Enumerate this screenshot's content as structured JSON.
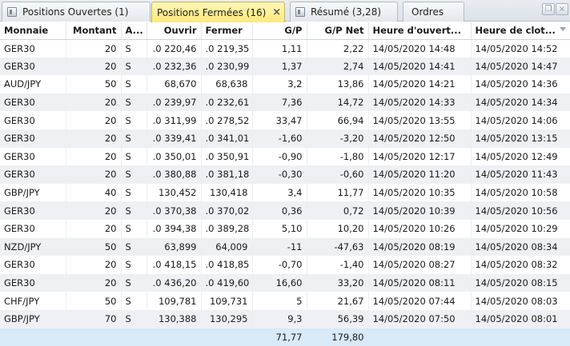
{
  "tabs": [
    {
      "label": "Positions Ouvertes (1)"
    },
    {
      "label": "Positions Fermées (16)",
      "close": "×"
    },
    {
      "label": "Résumé (3,28)"
    },
    {
      "label": "Ordres"
    }
  ],
  "window_buttons": {
    "restore": "❐",
    "close": "×"
  },
  "columns": [
    "Monnaie",
    "Montant",
    "A...",
    "Ouvrir",
    "Fermer",
    "G/P",
    "G/P Net",
    "Heure d'ouvert...",
    "Heure de clot..."
  ],
  "rows": [
    [
      "GER30",
      "20",
      "S",
      ".0 220,46",
      ".0 219,35",
      "1,11",
      "2,22",
      "14/05/2020 14:48",
      "14/05/2020 14:52"
    ],
    [
      "GER30",
      "20",
      "S",
      ".0 232,36",
      ".0 230,99",
      "1,37",
      "2,74",
      "14/05/2020 14:41",
      "14/05/2020 14:47"
    ],
    [
      "AUD/JPY",
      "50",
      "S",
      "68,670",
      "68,638",
      "3,2",
      "13,86",
      "14/05/2020 14:21",
      "14/05/2020 14:36"
    ],
    [
      "GER30",
      "20",
      "S",
      ".0 239,97",
      ".0 232,61",
      "7,36",
      "14,72",
      "14/05/2020 14:33",
      "14/05/2020 14:34"
    ],
    [
      "GER30",
      "20",
      "S",
      ".0 311,99",
      ".0 278,52",
      "33,47",
      "66,94",
      "14/05/2020 13:55",
      "14/05/2020 14:06"
    ],
    [
      "GER30",
      "20",
      "S",
      ".0 339,41",
      ".0 341,01",
      "-1,60",
      "-3,20",
      "14/05/2020 12:50",
      "14/05/2020 13:15"
    ],
    [
      "GER30",
      "20",
      "S",
      ".0 350,01",
      ".0 350,91",
      "-0,90",
      "-1,80",
      "14/05/2020 12:17",
      "14/05/2020 12:49"
    ],
    [
      "GER30",
      "20",
      "S",
      ".0 380,88",
      ".0 381,18",
      "-0,30",
      "-0,60",
      "14/05/2020 11:20",
      "14/05/2020 11:43"
    ],
    [
      "GBP/JPY",
      "40",
      "S",
      "130,452",
      "130,418",
      "3,4",
      "11,77",
      "14/05/2020 10:35",
      "14/05/2020 10:58"
    ],
    [
      "GER30",
      "20",
      "S",
      ".0 370,38",
      ".0 370,02",
      "0,36",
      "0,72",
      "14/05/2020 10:39",
      "14/05/2020 10:56"
    ],
    [
      "GER30",
      "20",
      "S",
      ".0 394,38",
      ".0 389,28",
      "5,10",
      "10,20",
      "14/05/2020 10:26",
      "14/05/2020 10:29"
    ],
    [
      "NZD/JPY",
      "50",
      "S",
      "63,899",
      "64,009",
      "-11",
      "-47,63",
      "14/05/2020 08:19",
      "14/05/2020 08:34"
    ],
    [
      "GER30",
      "20",
      "S",
      ".0 418,15",
      ".0 418,85",
      "-0,70",
      "-1,40",
      "14/05/2020 08:27",
      "14/05/2020 08:32"
    ],
    [
      "GER30",
      "20",
      "S",
      ".0 436,20",
      ".0 419,60",
      "16,60",
      "33,20",
      "14/05/2020 08:11",
      "14/05/2020 08:15"
    ],
    [
      "CHF/JPY",
      "50",
      "S",
      "109,781",
      "109,731",
      "5",
      "21,67",
      "14/05/2020 07:44",
      "14/05/2020 08:03"
    ],
    [
      "GBP/JPY",
      "70",
      "S",
      "130,388",
      "130,295",
      "9,3",
      "56,39",
      "14/05/2020 07:50",
      "14/05/2020 08:01"
    ]
  ],
  "totals": {
    "gp": "71,77",
    "gp_net": "179,80"
  }
}
